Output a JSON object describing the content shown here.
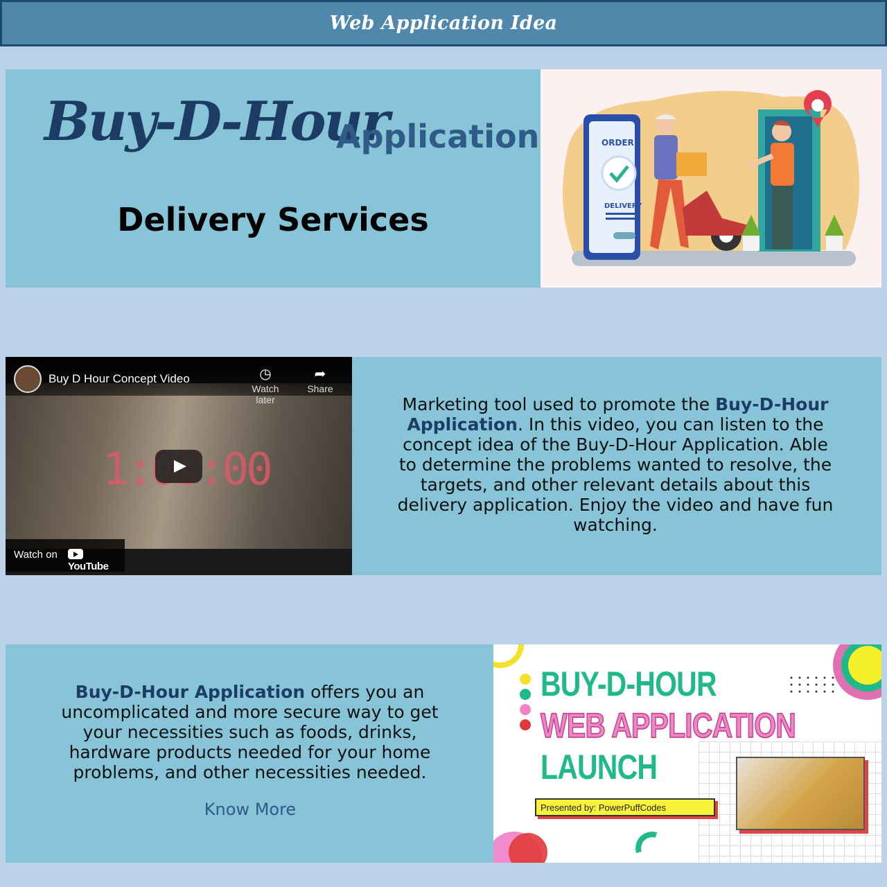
{
  "header": {
    "title": "Web Application Idea"
  },
  "hero": {
    "brand": "Buy-D-Hour",
    "brand_suffix": "Application",
    "subtitle": "Delivery Services",
    "illustration": {
      "phone_top": "ORDER",
      "phone_bottom": "DELIVERY"
    }
  },
  "video": {
    "title": "Buy D Hour Concept Video",
    "watch_later": "Watch later",
    "share": "Share",
    "watch_on": "Watch on",
    "youtube": "YouTube",
    "clock": "1:00:00"
  },
  "section2": {
    "p_pre": "Marketing tool used to promote the ",
    "p_bold": "Buy-D-Hour Application",
    "p_post": ". In this video, you can listen to the concept idea of the Buy-D-Hour Application. Able to determine the problems wanted to resolve, the targets, and other relevant details about this delivery application. Enjoy the video and have fun watching."
  },
  "section3": {
    "p_bold": "Buy-D-Hour Application",
    "p_post": " offers you an uncomplicated and more secure way to get your necessities such as foods, drinks, hardware products needed for your home problems, and other necessities needed.",
    "know_more": "Know More",
    "poster": {
      "line1": "BUY-D-HOUR",
      "line2": "WEB APPLICATION",
      "line3": "LAUNCH",
      "presented": "Presented by: PowerPuffCodes"
    }
  }
}
